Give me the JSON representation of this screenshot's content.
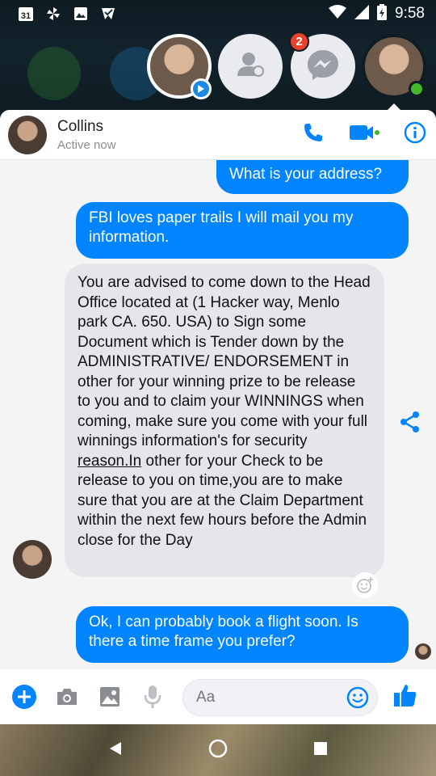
{
  "status_bar": {
    "time": "9:58",
    "calendar_day": "31",
    "left_icons": [
      "calendar-icon",
      "pinwheel-icon",
      "photo-icon",
      "check-icon"
    ],
    "right_icons": [
      "wifi-icon",
      "signal-icon",
      "battery-icon"
    ]
  },
  "chat_heads": {
    "badge_count": "2",
    "items": [
      "contact-avatar",
      "people-icon",
      "messenger-icon",
      "collins-avatar"
    ]
  },
  "header": {
    "name": "Collins",
    "status": "Active now"
  },
  "messages": [
    {
      "from": "me",
      "text": "What is your address?"
    },
    {
      "from": "me",
      "text": "FBI loves paper trails I will mail you my information."
    },
    {
      "from": "them",
      "text_before": "You are advised to come down to the Head Office located at (1 Hacker way, Menlo park CA. 650. USA) to Sign some Document which is Tender down by the ADMINISTRATIVE/ ENDORSEMENT in other for your winning prize to be release to you and to claim your WINNINGS when coming, make sure you come with your full winnings information's for security ",
      "link": "reason.In",
      "text_after": " other for your Check to be release to you on time,you are to make sure that you are at the Claim Department within the next few hours before the Admin close for the Day"
    },
    {
      "from": "me",
      "text": "Ok, I can probably book a flight soon. Is there a time frame you prefer?"
    }
  ],
  "composer": {
    "placeholder": "Aa"
  },
  "colors": {
    "messenger_blue": "#0084ff",
    "incoming_bubble": "#e4e6eb",
    "active_green": "#42b72a",
    "badge_red": "#e8412c"
  }
}
